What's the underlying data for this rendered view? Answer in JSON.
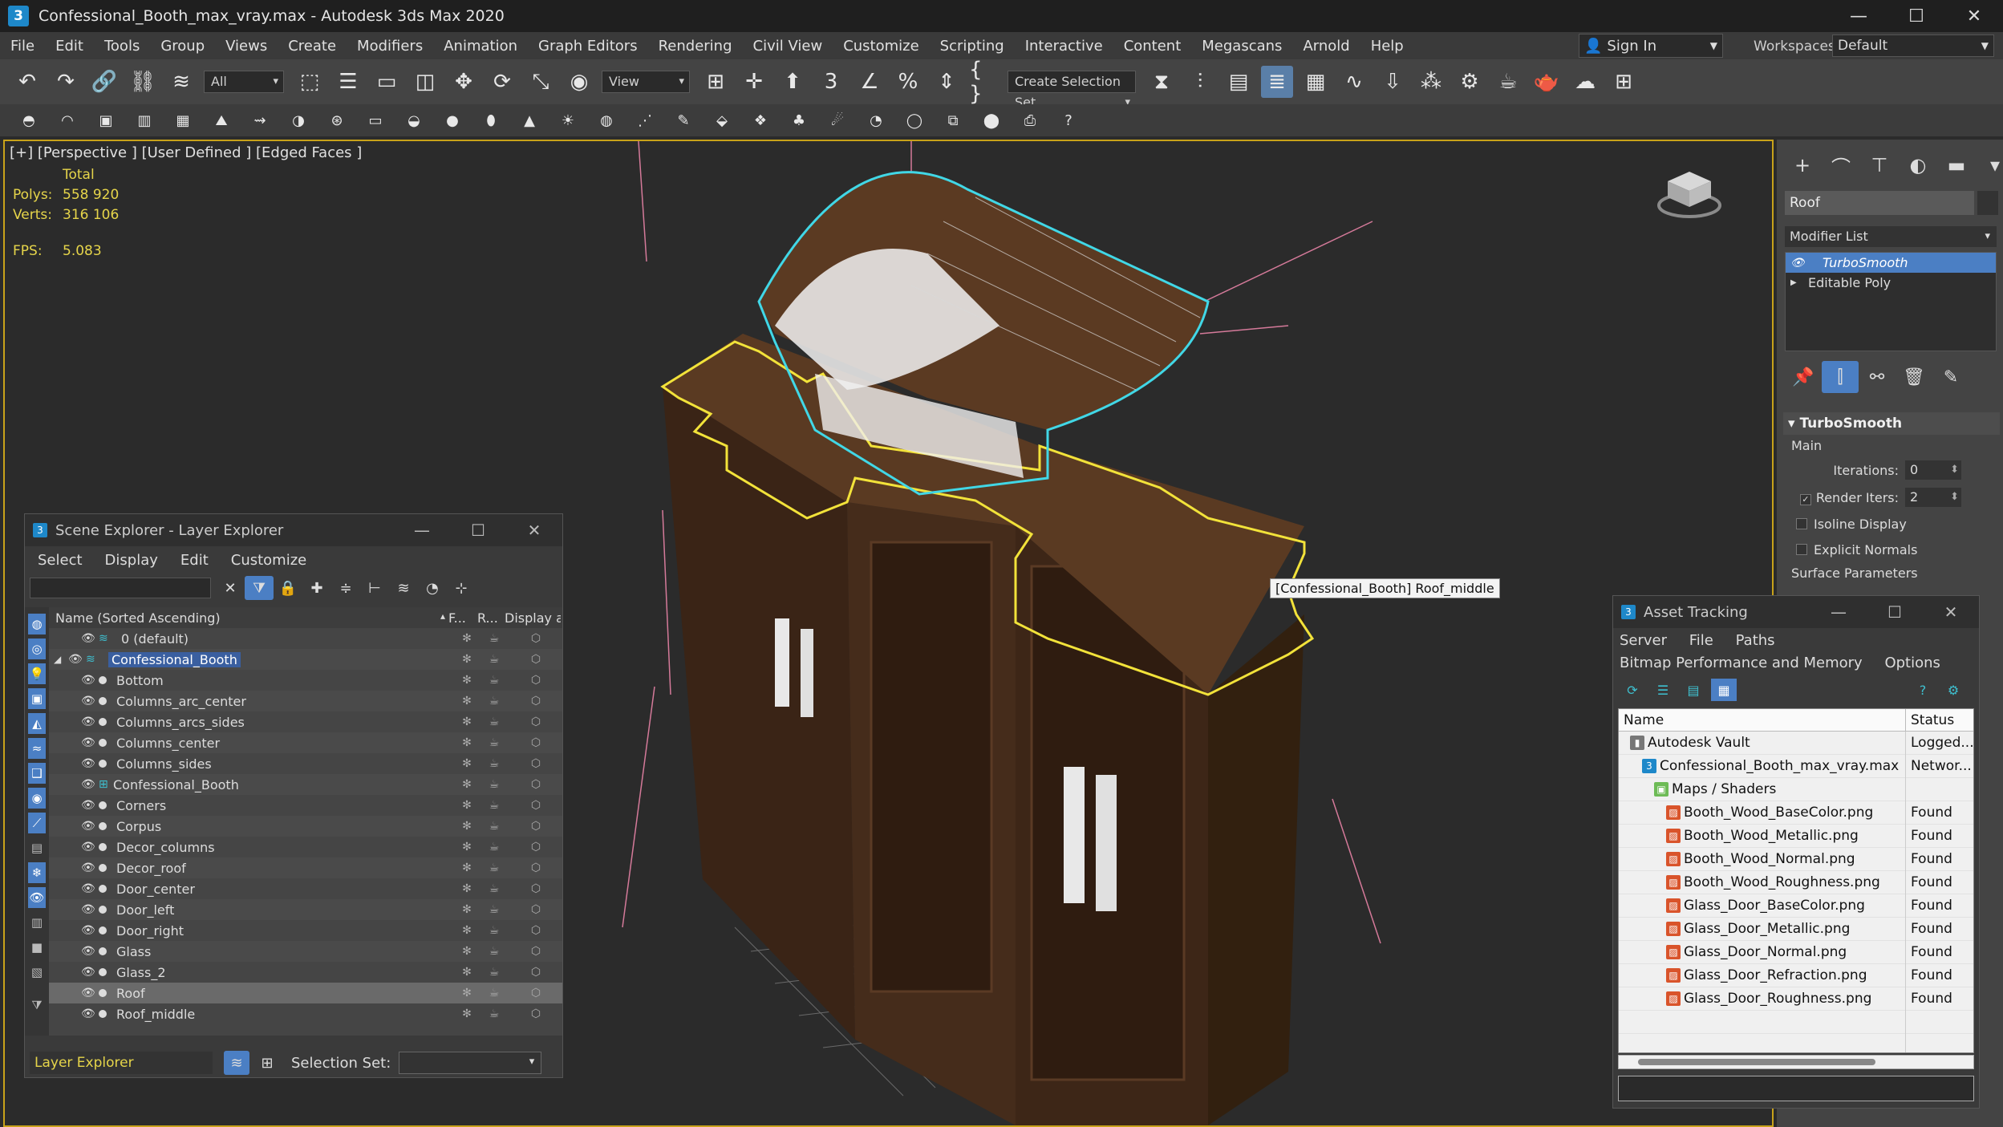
{
  "window": {
    "title": "Confessional_Booth_max_vray.max - Autodesk 3ds Max 2020",
    "app_letter": "3"
  },
  "menu": [
    "File",
    "Edit",
    "Tools",
    "Group",
    "Views",
    "Create",
    "Modifiers",
    "Animation",
    "Graph Editors",
    "Rendering",
    "Civil View",
    "Customize",
    "Scripting",
    "Interactive",
    "Content",
    "Megascans",
    "Arnold",
    "Help"
  ],
  "account": {
    "signin": "Sign In",
    "workspaces_label": "Workspaces:",
    "workspace": "Default"
  },
  "toolbar": {
    "filter": "All",
    "ref_coord": "View",
    "selection_set": "Create Selection Set"
  },
  "viewport": {
    "label": "[+] [Perspective ] [User Defined ] [Edged Faces ]",
    "stats_header": "Total",
    "polys_label": "Polys:",
    "polys": "558 920",
    "verts_label": "Verts:",
    "verts": "316 106",
    "fps_label": "FPS:",
    "fps": "5.083",
    "tooltip": "[Confessional_Booth] Roof_middle"
  },
  "command_panel": {
    "object_name": "Roof",
    "modifier_list": "Modifier List",
    "stack": [
      "TurboSmooth",
      "Editable Poly"
    ],
    "rollout_title": "TurboSmooth",
    "group_main": "Main",
    "iterations_label": "Iterations:",
    "iterations": "0",
    "render_iters_label": "Render Iters:",
    "render_iters": "2",
    "isoline": "Isoline Display",
    "explicit_normals": "Explicit Normals",
    "surface_params": "Surface Parameters"
  },
  "scene_explorer": {
    "title": "Scene Explorer - Layer Explorer",
    "menus": [
      "Select",
      "Display",
      "Edit",
      "Customize"
    ],
    "columns": {
      "name": "Name (Sorted Ascending)",
      "freeze": "F...",
      "render": "R...",
      "display": "Display as ..."
    },
    "default_layer": "0 (default)",
    "layer": "Confessional_Booth",
    "children": [
      "Bottom",
      "Columns_arc_center",
      "Columns_arcs_sides",
      "Columns_center",
      "Columns_sides",
      "Confessional_Booth",
      "Corners",
      "Corpus",
      "Decor_columns",
      "Decor_roof",
      "Door_center",
      "Door_left",
      "Door_right",
      "Glass",
      "Glass_2",
      "Roof",
      "Roof_middle"
    ],
    "footer_explorer": "Layer Explorer",
    "selection_set_label": "Selection Set:"
  },
  "asset_tracking": {
    "title": "Asset Tracking",
    "menus_row1": [
      "Server",
      "File",
      "Paths"
    ],
    "menus_row2": [
      "Bitmap Performance and Memory",
      "Options"
    ],
    "col_name": "Name",
    "col_status": "Status",
    "rows": [
      {
        "name": "Autodesk Vault",
        "status": "Logged...",
        "level": 1,
        "icon": "vault"
      },
      {
        "name": "Confessional_Booth_max_vray.max",
        "status": "Networ...",
        "level": 2,
        "icon": "max"
      },
      {
        "name": "Maps / Shaders",
        "status": "",
        "level": 3,
        "icon": "folder"
      },
      {
        "name": "Booth_Wood_BaseColor.png",
        "status": "Found",
        "level": 4,
        "icon": "img"
      },
      {
        "name": "Booth_Wood_Metallic.png",
        "status": "Found",
        "level": 4,
        "icon": "img"
      },
      {
        "name": "Booth_Wood_Normal.png",
        "status": "Found",
        "level": 4,
        "icon": "img"
      },
      {
        "name": "Booth_Wood_Roughness.png",
        "status": "Found",
        "level": 4,
        "icon": "img"
      },
      {
        "name": "Glass_Door_BaseColor.png",
        "status": "Found",
        "level": 4,
        "icon": "img"
      },
      {
        "name": "Glass_Door_Metallic.png",
        "status": "Found",
        "level": 4,
        "icon": "img"
      },
      {
        "name": "Glass_Door_Normal.png",
        "status": "Found",
        "level": 4,
        "icon": "img"
      },
      {
        "name": "Glass_Door_Refraction.png",
        "status": "Found",
        "level": 4,
        "icon": "img"
      },
      {
        "name": "Glass_Door_Roughness.png",
        "status": "Found",
        "level": 4,
        "icon": "img"
      }
    ]
  },
  "colors": {
    "selection_yellow": "#e6d54a",
    "highlight_cyan": "#41d7e6",
    "accent_blue": "#4b7fc4",
    "wood": "#4a2f1e"
  }
}
